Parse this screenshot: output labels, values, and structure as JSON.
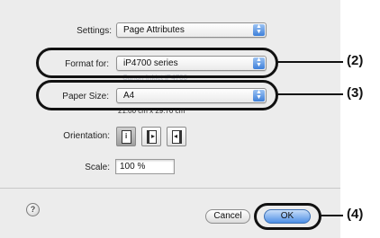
{
  "settings": {
    "label": "Settings:",
    "value": "Page Attributes"
  },
  "format_for": {
    "label": "Format for:",
    "value": "iP4700 series",
    "subtext": "Canon Inkjet iP4700"
  },
  "paper_size": {
    "label": "Paper Size:",
    "value": "A4",
    "dimensions": "21.00 cm x 29.70 cm"
  },
  "orientation": {
    "label": "Orientation:",
    "selected": "portrait"
  },
  "scale": {
    "label": "Scale:",
    "value": "100 %"
  },
  "buttons": {
    "help": "?",
    "cancel": "Cancel",
    "ok": "OK"
  },
  "callouts": {
    "format_for": "(2)",
    "paper_size": "(3)",
    "ok": "(4)"
  },
  "colors": {
    "dialog_bg": "#ececec",
    "popup_arrow": "#3d7fd9",
    "default_button": "#4d8fe6",
    "callout_ring": "#111111"
  }
}
